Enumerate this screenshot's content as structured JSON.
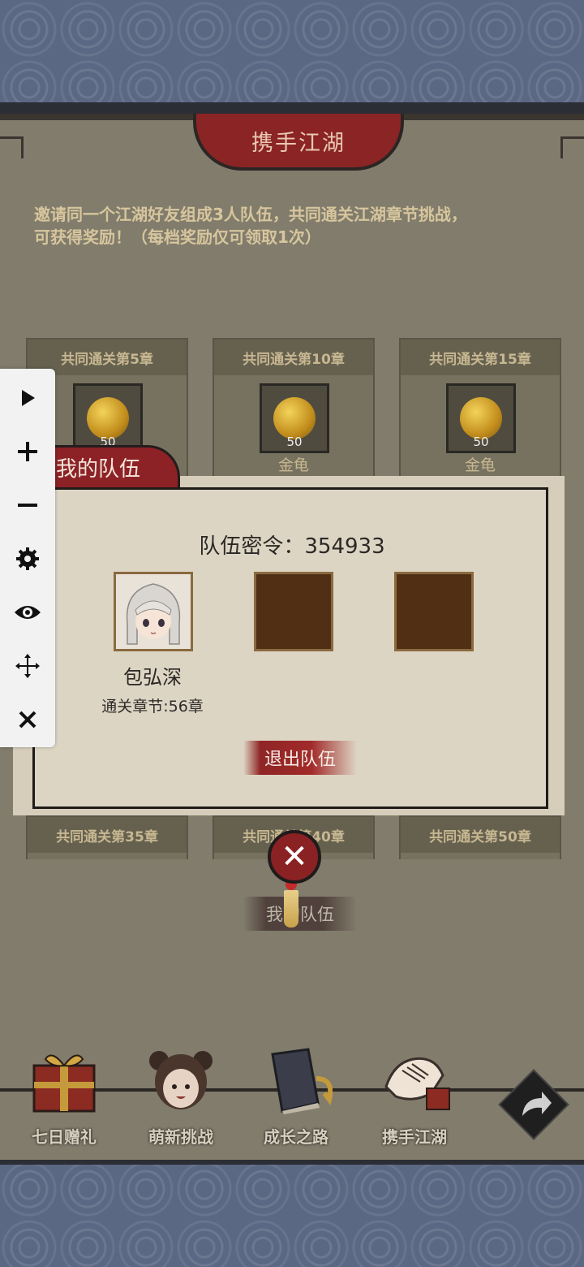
{
  "header": {
    "title": "携手江湖"
  },
  "intro": {
    "line1": "邀请同一个江湖好友组成3人队伍，共同通关江湖章节挑战，",
    "line2": "可获得奖励！（每档奖励仅可领取1次）"
  },
  "rewards_top": [
    {
      "title": "共同通关第5章",
      "count": "50",
      "name": "金龟"
    },
    {
      "title": "共同通关第10章",
      "count": "50",
      "name": "金龟"
    },
    {
      "title": "共同通关第15章",
      "count": "50",
      "name": "金龟"
    }
  ],
  "rewards_bottom": [
    {
      "title": "共同通关第35章"
    },
    {
      "title": "共同通关第40章"
    },
    {
      "title": "共同通关第50章"
    }
  ],
  "popup": {
    "tab_label": "我的队伍",
    "passcode_label": "队伍密令：",
    "passcode_value": "354933",
    "member": {
      "name": "包弘深",
      "progress": "通关章节:56章"
    },
    "exit_label": "退出队伍"
  },
  "my_team_button": "我的队伍",
  "bottom_nav": [
    {
      "label": "七日赠礼",
      "icon": "gift-box-icon"
    },
    {
      "label": "萌新挑战",
      "icon": "girl-avatar-icon"
    },
    {
      "label": "成长之路",
      "icon": "book-icon"
    },
    {
      "label": "携手江湖",
      "icon": "handshake-icon"
    },
    {
      "label": "",
      "icon": "share-arrow-icon"
    }
  ],
  "toolbar": [
    "play-icon",
    "plus-icon",
    "minus-icon",
    "gear-icon",
    "eye-icon",
    "move-icon",
    "close-icon"
  ]
}
